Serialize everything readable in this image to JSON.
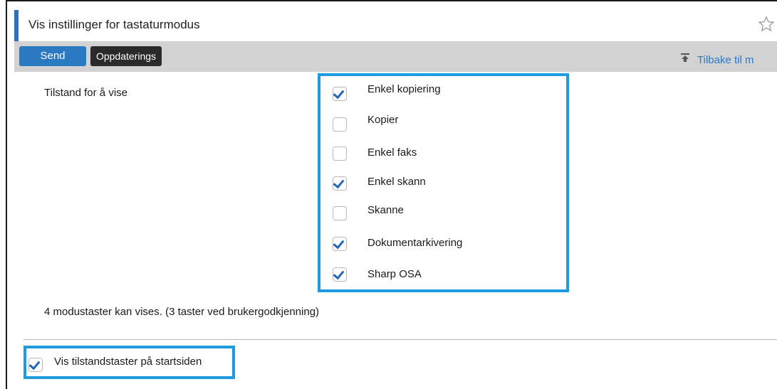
{
  "header": {
    "title": "Vis instillinger for tastaturmodus"
  },
  "toolbar": {
    "send_label": "Send",
    "update_label": "Oppdaterings",
    "back_label": "Tilbake til m"
  },
  "mode_section": {
    "label": "Tilstand for å vise",
    "options": [
      {
        "label": "Enkel kopiering",
        "checked": true
      },
      {
        "label": "Kopier",
        "checked": false
      },
      {
        "label": "Enkel faks",
        "checked": false
      },
      {
        "label": "Enkel skann",
        "checked": true
      },
      {
        "label": "Skanne",
        "checked": false
      },
      {
        "label": "Dokumentarkivering",
        "checked": true
      },
      {
        "label": "Sharp OSA",
        "checked": true
      }
    ],
    "info_text": "4 modustaster kan vises. (3 taster ved brukergodkjenning)"
  },
  "home_option": {
    "label": "Vis tilstandstaster på startsiden",
    "checked": true
  },
  "colors": {
    "accent": "#2a7ac2",
    "highlight": "#1e9be0",
    "check": "#2366b8"
  }
}
